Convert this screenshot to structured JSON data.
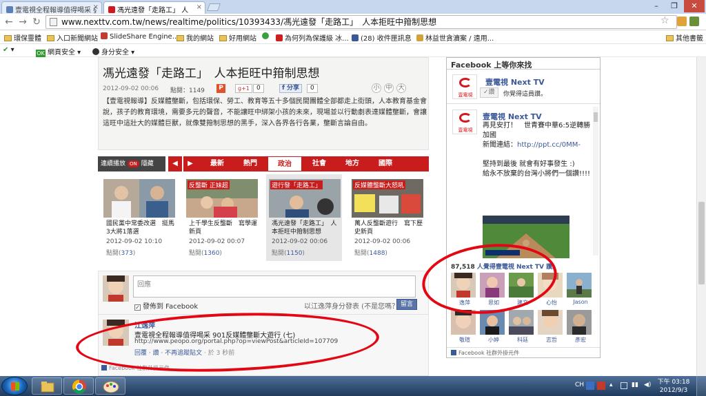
{
  "browser": {
    "tabs": [
      {
        "label": "壹電視全程報導值得喝采 §"
      },
      {
        "label": "馮光遠發「走路工」 人"
      }
    ],
    "url": "www.nexttv.com.tw/news/realtime/politics/10393433/馮光遠發「走路工」　人本拒旺中箝制思想",
    "bookmarks": [
      "環保靈體",
      "入口新聞網站",
      "SlideShare Engine...",
      "我的網站",
      "好用網站",
      "為何列為保護級 冰...",
      "(28) 收件匣訊息",
      "林益世貪瀆案 / 遠用...",
      "其他書籤"
    ],
    "security_items": [
      "網頁安全",
      "身分安全"
    ],
    "ok_label": "OK"
  },
  "article": {
    "title": "馮光遠發「走路工」　人本拒旺中箝制思想",
    "datetime": "2012-09-02 00:06",
    "clicks_label": "點閱：1149",
    "p_label": "P",
    "gplus_label": "g+1",
    "gplus_count": "0",
    "fb_share": "f 分享",
    "fb_count": "0",
    "font_sizes": [
      "小",
      "中",
      "大"
    ],
    "body": "【壹電視報導】反媒體壟斷，包括環保、勞工、教育等五十多個民間團體全部都走上街頭，人本教育基金會說，孩子的教育環境，需要多元的聲音，不能讓旺中綁架小孩的未來，現場並以行動劇表達媒體壟斷，會讓這旺中這壯大的媒體巨獸，就像雙箝制思想的黑手，深入各界各行各業，壟斷言論自由。"
  },
  "channel": {
    "autoplay": "連續播放",
    "autoplay_state": "ON",
    "hide": "隱藏",
    "prev": "◀",
    "next": "▶",
    "tabs": [
      "最新",
      "熱門",
      "政治",
      "社會",
      "地方",
      "國際"
    ],
    "selected_tab": "政治"
  },
  "thumbs": [
    {
      "caption": "國民黨中常委改選　挺馬3大將1落選",
      "date": "2012-09-02 10:10",
      "views_prefix": "點閱(",
      "views": "373",
      "views_suffix": ")",
      "banner": ""
    },
    {
      "caption": "上千學生反壟斷　寫學運新頁",
      "date": "2012-09-02 00:07",
      "views_prefix": "點閱(",
      "views": "1360",
      "views_suffix": ")",
      "banner": "反壟斷 正妹超"
    },
    {
      "caption": "馮光遠發「走路工」　人本拒旺中箝制思想",
      "date": "2012-09-02 00:06",
      "views_prefix": "點閱(",
      "views": "1150",
      "views_suffix": ")",
      "banner": "遊行發「走路工」"
    },
    {
      "caption": "萬人反壟斷遊行　寫下歷史新頁",
      "date": "2012-09-02 00:06",
      "views_prefix": "點閱(",
      "views": "1488",
      "views_suffix": ")",
      "banner": "反媒體壟斷大怒吼"
    }
  ],
  "comments": {
    "placeholder": "回應",
    "post_to_fb": "發佈到 Facebook",
    "post_as": "以江逸萍身分發表 (不是您嗎？)",
    "post_button": "留言",
    "entry": {
      "name": "江逸萍",
      "text": "壹電視全程報導值得喝采 901反媒體壟斷大遊行 (七)",
      "url": "http://www.peopo.org/portal.php?op=viewPost&articleId=107709",
      "actions": "回覆 · 讚 · 不再追蹤貼文",
      "time": " · 於 3 秒前"
    },
    "plugin_label": "Facebook 社群外掛元件"
  },
  "fb_sidebar": {
    "header": "Facebook 上等你來找",
    "logo_text": "壹電視",
    "page_name": "壹電視 Next TV",
    "like_button": "✓讚",
    "like_text": "你覺得這員讚。",
    "post": {
      "name": "壹電視 Next TV",
      "text_before": "再見安打！　世青賽中華6:5逆轉勝加國\n新聞連結：",
      "link": "http://ppt.cc/0MM-",
      "text_after": "\n\n堅持到最後 就會有好事發生 :)\n給永不放棄的台灣小將們一個讚!!!!"
    },
    "fans_count": "87,518",
    "fans_text": " 人覺得壹電視 Next TV 讚。",
    "fans": [
      "逸萍",
      "思如",
      "建文",
      "心怡",
      "Jason",
      "敬瑄",
      "小婷",
      "科廷",
      "志哲",
      "彥宏"
    ],
    "footer": "Facebook 社群外掛元件"
  },
  "taskbar": {
    "lang": "CH",
    "time": "下午 03:18",
    "date": "2012/9/3"
  },
  "colors": {
    "accent_red": "#c91c1c",
    "fb_blue": "#3b5998",
    "annotation_red": "#e30613"
  }
}
